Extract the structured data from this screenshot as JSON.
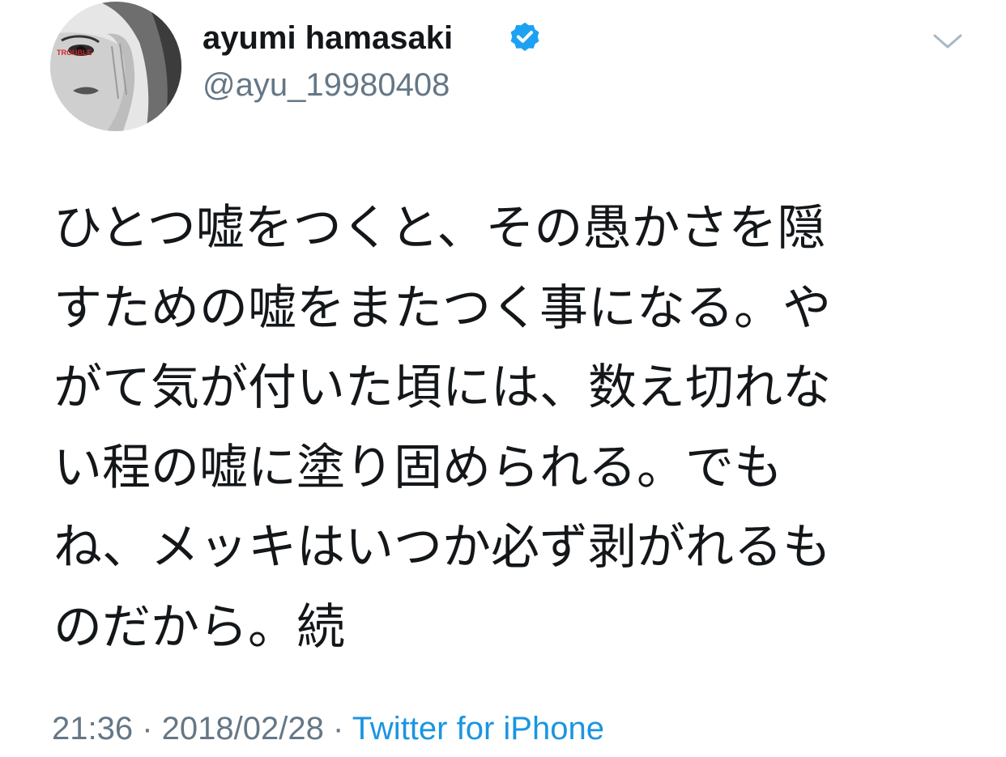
{
  "user": {
    "display_name": "ayumi hamasaki",
    "handle": "@ayu_19980408",
    "verified": true,
    "avatar_caption": "TROUBLE"
  },
  "tweet": {
    "lines": [
      "ひとつ嘘をつくと、その愚かさを隠",
      "すための嘘をまたつく事になる。や",
      "がて気が付いた頃には、数え切れな",
      "い程の嘘に塗り固められる。でも",
      "ね、メッキはいつか必ず剥がれるも",
      "のだから。続"
    ]
  },
  "meta": {
    "time": "21:36",
    "separator": " · ",
    "date": "2018/02/28",
    "source": "Twitter for iPhone"
  },
  "colors": {
    "text": "#14171a",
    "secondary": "#657786",
    "link": "#1b95e0",
    "verified": "#1da1f2"
  },
  "icons": {
    "verified": "verified-badge-icon",
    "menu": "chevron-down-icon"
  }
}
